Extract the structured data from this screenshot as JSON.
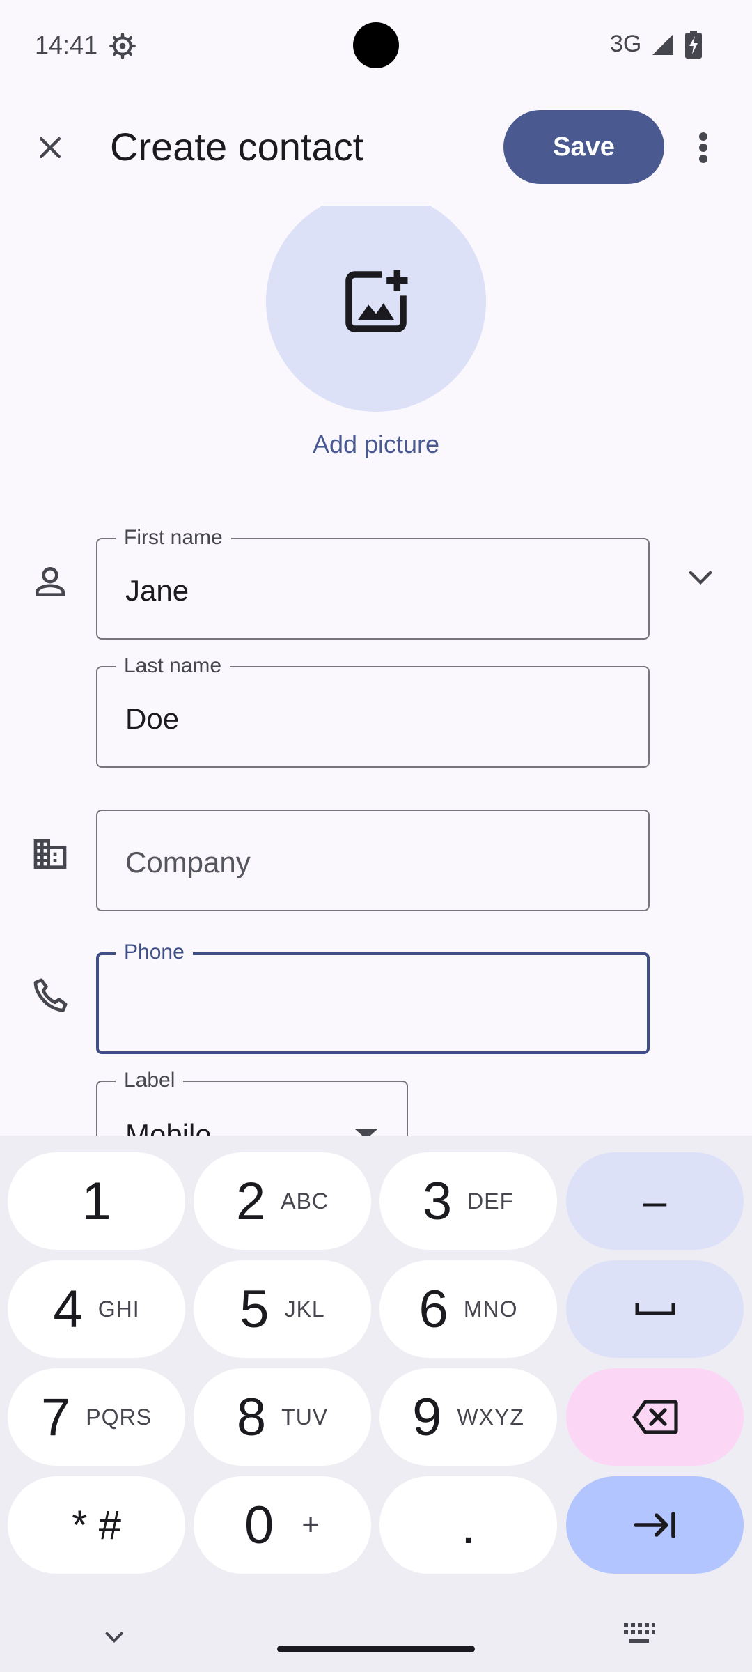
{
  "status_bar": {
    "time": "14:41",
    "network": "3G",
    "icons": [
      "settings-gear-icon",
      "signal-icon",
      "battery-charging-icon"
    ]
  },
  "app_bar": {
    "title": "Create contact",
    "save_label": "Save",
    "icons": [
      "close-icon",
      "more-vert-icon"
    ]
  },
  "photo": {
    "add_label": "Add picture",
    "icon": "add-photo-icon"
  },
  "form": {
    "first_name": {
      "label": "First name",
      "value": "Jane"
    },
    "last_name": {
      "label": "Last name",
      "value": "Doe"
    },
    "company": {
      "placeholder": "Company",
      "value": ""
    },
    "phone": {
      "label": "Phone",
      "value": "",
      "focused": true
    },
    "phone_type": {
      "label": "Label",
      "value": "Mobile"
    }
  },
  "keyboard": {
    "rows": [
      [
        {
          "num": "1",
          "sub": ""
        },
        {
          "num": "2",
          "sub": "ABC"
        },
        {
          "num": "3",
          "sub": "DEF"
        },
        {
          "num": "–",
          "sub": ""
        }
      ],
      [
        {
          "num": "4",
          "sub": "GHI"
        },
        {
          "num": "5",
          "sub": "JKL"
        },
        {
          "num": "6",
          "sub": "MNO"
        },
        {
          "num": "␣",
          "sub": ""
        }
      ],
      [
        {
          "num": "7",
          "sub": "PQRS"
        },
        {
          "num": "8",
          "sub": "TUV"
        },
        {
          "num": "9",
          "sub": "WXYZ"
        },
        {
          "num": "⌫",
          "sub": ""
        }
      ],
      [
        {
          "num": "* #",
          "sub": ""
        },
        {
          "num": "0",
          "sub": "+"
        },
        {
          "num": ".",
          "sub": ""
        },
        {
          "num": "⇥",
          "sub": ""
        }
      ]
    ],
    "colors": {
      "key": "#ffffff",
      "function": "#dde1f8",
      "delete": "#fbd7f5",
      "next": "#b3c5ff"
    }
  },
  "colors": {
    "primary": "#4a5a91",
    "background": "#fbf8fd",
    "avatar_bg": "#dde1f8"
  }
}
